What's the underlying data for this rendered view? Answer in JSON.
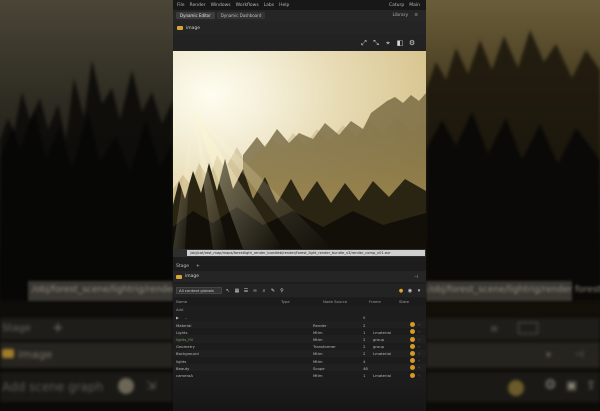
{
  "menubar": {
    "items": [
      "File",
      "Render",
      "Windows",
      "Workflows",
      "Labs",
      "Help"
    ],
    "right_items": [
      "Caturp",
      "Main"
    ]
  },
  "tabs": [
    {
      "label": "Dynamic Editor",
      "active": true
    },
    {
      "label": "Dynamic Dashboard",
      "active": false
    }
  ],
  "tabs_right": [
    "Library"
  ],
  "viewer": {
    "folder_label": "image",
    "path": "/obj/cat/rest_map/maps/forestlight_render_bundleb/render/forest_light_render_bundle_v3/render_comp_v01.exr"
  },
  "network": {
    "tab_label": "Stage",
    "folder_label": "image",
    "select_value": "All context globals",
    "columns": [
      "Name",
      "Type",
      "Node Source",
      "Frame",
      "State"
    ],
    "add_label": "Add",
    "parent_label": "..",
    "parent_value": "0",
    "rows": [
      {
        "name": "Material",
        "type": "Render",
        "count": "2",
        "kind": ""
      },
      {
        "name": "Lights",
        "type": "Mtlm",
        "count": "1",
        "kind": "Lmaterial"
      },
      {
        "name": "lights_fill",
        "type": "Mtlm",
        "count": "2",
        "kind": "group"
      },
      {
        "name": "Geometry",
        "type": "Transformer",
        "count": "2",
        "kind": "group"
      },
      {
        "name": "Background",
        "type": "Mtlm",
        "count": "2",
        "kind": "Lmaterial"
      },
      {
        "name": "lights",
        "type": "Mtlm",
        "count": "4",
        "kind": ""
      },
      {
        "name": "Beauty",
        "type": "Scope",
        "count": "48",
        "kind": ""
      },
      {
        "name": "cameraA",
        "type": "Mtlm",
        "count": "1",
        "kind": "Lmaterial"
      }
    ]
  },
  "background": {
    "bar_text": "/obj/forest_scene/lightrig/render   forestlight_render_bundle/render_comp_v01.exr   [rendered comp frame 3.4]",
    "left_tab_label": "Stage",
    "left_folder_label": "image",
    "left_bottom_text": "Add scene graph"
  },
  "colors": {
    "accent": "#d59a25",
    "panel": "#1f1f1f"
  }
}
